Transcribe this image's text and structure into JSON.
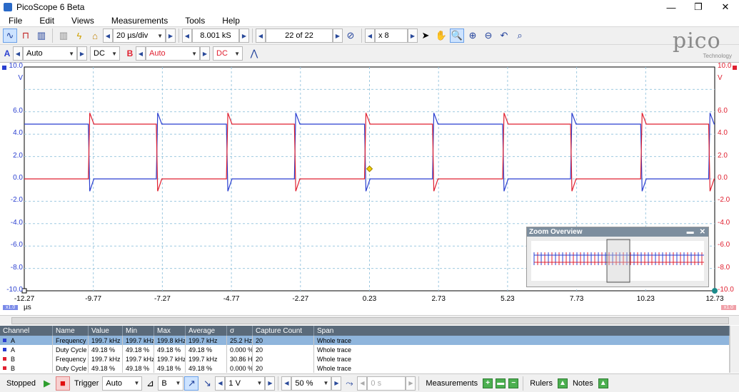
{
  "window": {
    "title": "PicoScope 6 Beta",
    "minimize": "—",
    "restore": "❐",
    "close": "✕"
  },
  "menu": [
    "File",
    "Edit",
    "Views",
    "Measurements",
    "Tools",
    "Help"
  ],
  "toolbar1": {
    "timebase": "20 µs/div",
    "samples": "8.001 kS",
    "buffer": "22 of 22",
    "zoom": "x 8"
  },
  "toolbar2": {
    "channel_a": {
      "label": "A",
      "range": "Auto",
      "coupling": "DC"
    },
    "channel_b": {
      "label": "B",
      "range": "Auto",
      "coupling": "DC"
    }
  },
  "logo": {
    "text": "pico",
    "sub": "Technology"
  },
  "scope": {
    "y_left_labels": [
      "10.0",
      "V",
      "6.0",
      "4.0",
      "2.0",
      "0.0",
      "-2.0",
      "-4.0",
      "-6.0",
      "-8.0",
      "-10.0"
    ],
    "y_right_labels": [
      "10.0",
      "V",
      "6.0",
      "4.0",
      "2.0",
      "0.0",
      "-2.0",
      "-4.0",
      "-6.0",
      "-8.0",
      "-10.0"
    ],
    "x_labels": [
      "-12.27",
      "-9.77",
      "-7.27",
      "-4.77",
      "-2.27",
      "0.23",
      "2.73",
      "5.23",
      "7.73",
      "10.23",
      "12.73"
    ],
    "x_unit": "µs",
    "left_scale_badge": "x1.0",
    "right_scale_badge": "x1.0",
    "colors": {
      "channel_a": "#2a3fd0",
      "channel_b": "#e02030",
      "grid": "#9ec9e0"
    },
    "zoom_overview_title": "Zoom Overview"
  },
  "chart_data": {
    "type": "line",
    "xlabel": "µs",
    "ylabel": "V",
    "xlim": [
      -12.27,
      12.73
    ],
    "ylim": [
      -10,
      10
    ],
    "grid": true,
    "series": [
      {
        "name": "A",
        "color": "#2a3fd0",
        "period_us": 5.0,
        "duty": 0.4918,
        "high_v": 4.9,
        "low_v": 0.0,
        "first_fall_us": -9.95
      },
      {
        "name": "B",
        "color": "#e02030",
        "period_us": 5.0,
        "duty": 0.4918,
        "high_v": 4.9,
        "low_v": 0.0,
        "first_rise_us": -9.95
      }
    ]
  },
  "measurements": {
    "headers": [
      "Channel",
      "Name",
      "Value",
      "Min",
      "Max",
      "Average",
      "σ",
      "Capture Count",
      "Span"
    ],
    "rows": [
      [
        "A",
        "Frequency",
        "199.7 kHz",
        "199.7 kHz",
        "199.8 kHz",
        "199.7 kHz",
        "25.2 Hz",
        "20",
        "Whole trace"
      ],
      [
        "A",
        "Duty Cycle",
        "49.18 %",
        "49.18 %",
        "49.18 %",
        "49.18 %",
        "0.000 %",
        "20",
        "Whole trace"
      ],
      [
        "B",
        "Frequency",
        "199.7 kHz",
        "199.7 kHz",
        "199.7 kHz",
        "199.7 kHz",
        "30.86 Hz",
        "20",
        "Whole trace"
      ],
      [
        "B",
        "Duty Cycle",
        "49.18 %",
        "49.18 %",
        "49.18 %",
        "49.18 %",
        "0.000 %",
        "20",
        "Whole trace"
      ]
    ]
  },
  "status": {
    "state": "Stopped",
    "trigger_label": "Trigger",
    "trigger_mode": "Auto",
    "trigger_source": "B",
    "threshold": "1 V",
    "pre_trigger": "50 %",
    "delay": "0 s",
    "measurements_label": "Measurements",
    "rulers_label": "Rulers",
    "notes_label": "Notes"
  }
}
